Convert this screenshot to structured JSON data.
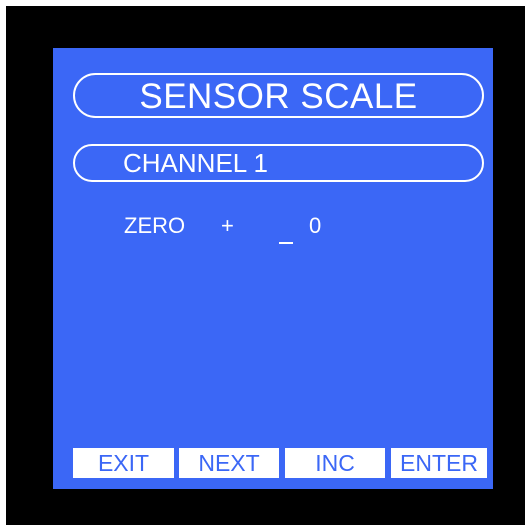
{
  "screen": {
    "title": "SENSOR SCALE",
    "channel": "CHANNEL 1",
    "parameter": {
      "label": "ZERO",
      "sign": "+",
      "value": "0"
    },
    "softkeys": {
      "exit": "EXIT",
      "next": "NEXT",
      "inc": "INC",
      "enter": "ENTER"
    }
  },
  "colors": {
    "bezel": "#000000",
    "screen_background": "#3b67f6",
    "foreground": "#ffffff",
    "softkey_text": "#3b67f6"
  }
}
